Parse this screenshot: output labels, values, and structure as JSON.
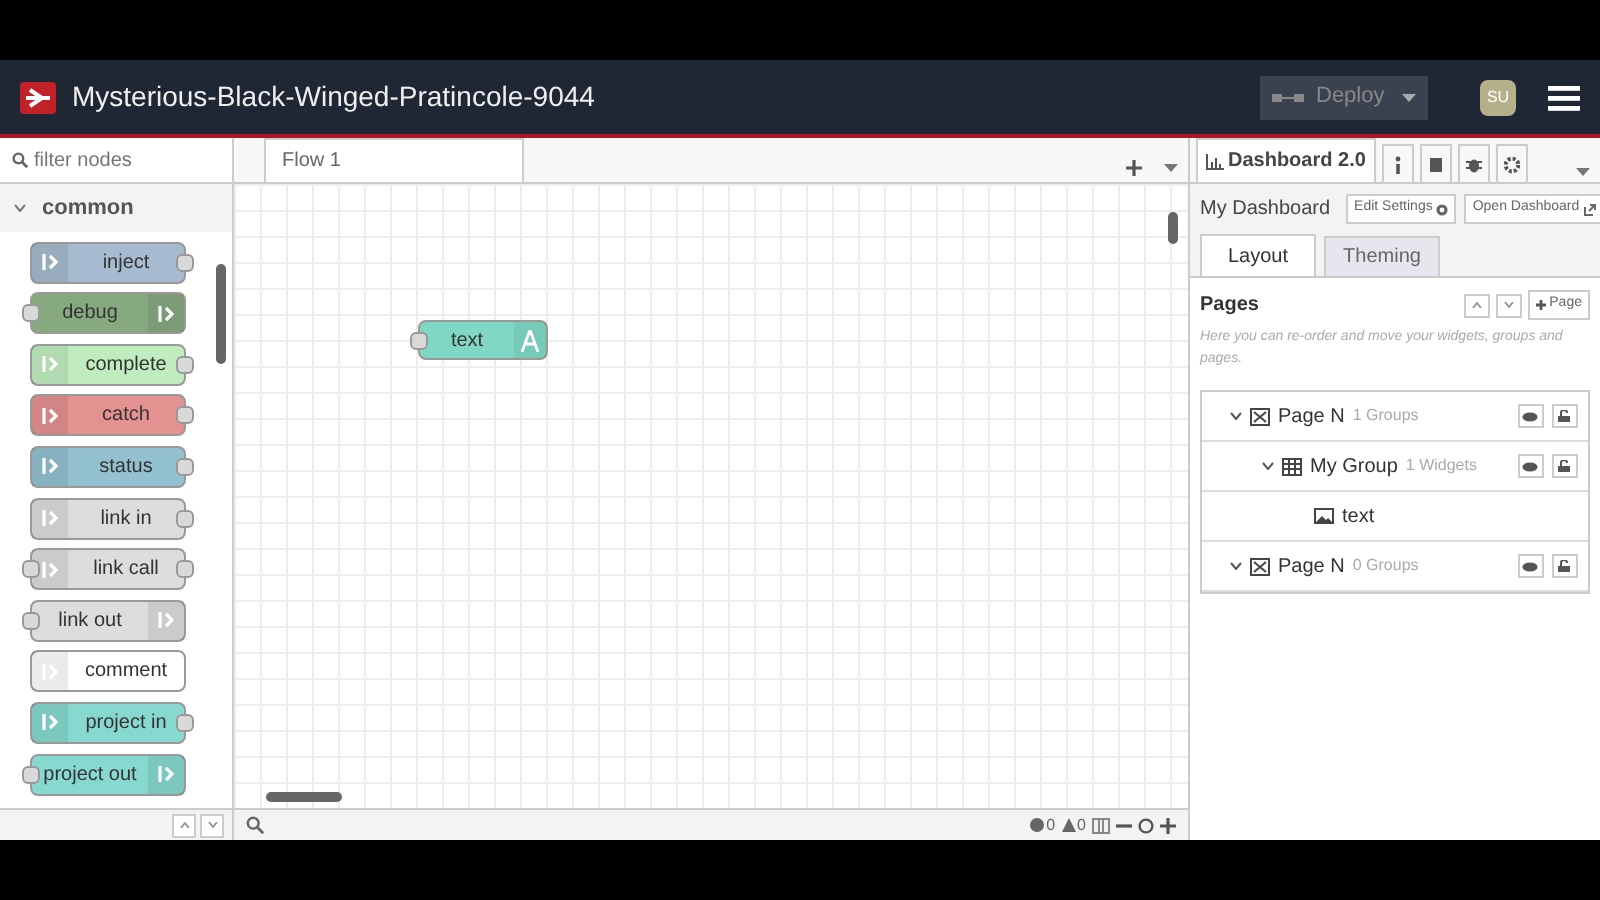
{
  "header": {
    "title": "Mysterious-Black-Winged-Pratincole-9044",
    "deploy": "Deploy",
    "user": "SU"
  },
  "palette": {
    "placeholder": "filter nodes",
    "category": "common",
    "expanded": true,
    "nodes": [
      {
        "label": "inject",
        "color": "#a6bbcf",
        "kind": "source",
        "input": false,
        "output": true
      },
      {
        "label": "debug",
        "color": "#87a980",
        "kind": "sink",
        "input": true,
        "output": false
      },
      {
        "label": "complete",
        "color": "#c0edc0",
        "kind": "source",
        "input": false,
        "output": true
      },
      {
        "label": "catch",
        "color": "#e49191",
        "kind": "source",
        "input": false,
        "output": true
      },
      {
        "label": "status",
        "color": "#94c1d0",
        "kind": "source",
        "input": false,
        "output": true
      },
      {
        "label": "link in",
        "color": "#dddddd",
        "kind": "source",
        "input": false,
        "output": true
      },
      {
        "label": "link call",
        "color": "#dddddd",
        "kind": "source",
        "input": true,
        "output": true
      },
      {
        "label": "link out",
        "color": "#dddddd",
        "kind": "sink",
        "input": true,
        "output": false
      },
      {
        "label": "comment",
        "color": "#ffffff",
        "kind": "source",
        "input": false,
        "output": false
      },
      {
        "label": "project in",
        "color": "#87d8cf",
        "kind": "source",
        "input": false,
        "output": true
      },
      {
        "label": "project out",
        "color": "#87d8cf",
        "kind": "sink",
        "input": true,
        "output": false
      }
    ]
  },
  "workspace": {
    "tabs": [
      {
        "label": "Flow 1",
        "selected": true
      }
    ],
    "nodes": [
      {
        "label": "text",
        "color": "#7fd7c4",
        "input": true,
        "output": false
      }
    ],
    "footer": {
      "errors": "0",
      "warnings": "0"
    }
  },
  "sidebar": {
    "tab": {
      "label": "Dashboard 2.0",
      "selected": true
    },
    "dashboard": "My Dashboard",
    "edit_button": "Edit Settings",
    "open_button": "Open Dashboard",
    "subtabs": [
      {
        "label": "Layout",
        "selected": true
      },
      {
        "label": "Theming",
        "selected": false
      }
    ],
    "section": "Pages",
    "add_button": "Page",
    "help": "Here you can re-order and move your widgets, groups and pages.",
    "tree": [
      {
        "kind": "page",
        "label": "Page N",
        "count": "1 Groups",
        "expanded": true,
        "children": [
          {
            "kind": "group",
            "label": "My Group",
            "count": "1 Widgets",
            "expanded": true,
            "children": [
              {
                "kind": "widget",
                "label": "text"
              }
            ]
          }
        ]
      },
      {
        "kind": "page",
        "label": "Page N",
        "count": "0 Groups",
        "expanded": true
      }
    ]
  }
}
